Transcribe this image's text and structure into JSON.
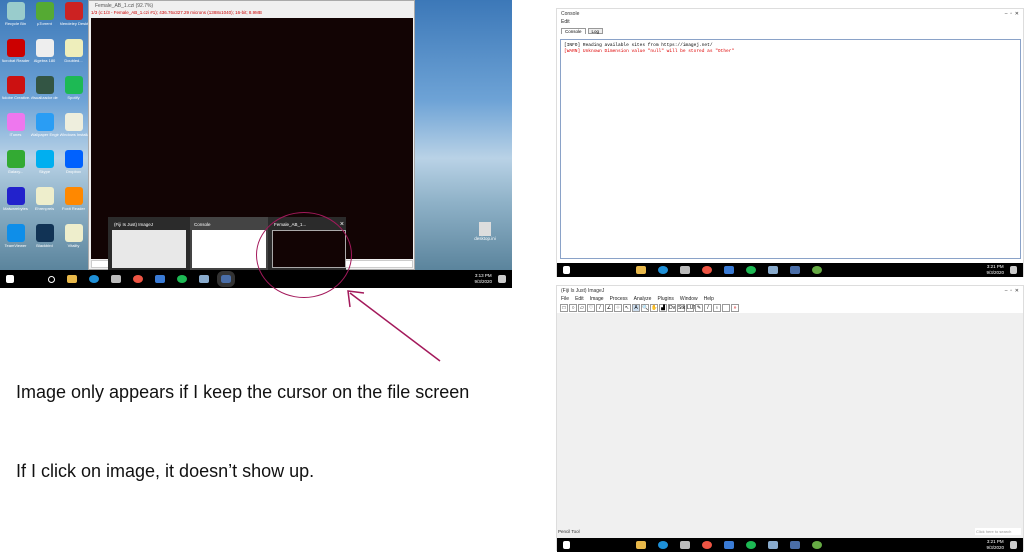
{
  "left_screenshot": {
    "desktop_icons": [
      "Recycle Bin",
      "µTorrent",
      "Mendeley Desktop",
      "Acrobat Reader DC",
      "Algebra 180",
      "Doubled...",
      "Adobe Creative...",
      "Visualizador de fotos",
      "Spotify",
      "iTunes",
      "Wallpaper Engine",
      "Windows Installation",
      "Galaxy...",
      "Skype",
      "Dropbox",
      "Malwarebytes",
      "Ehrenpreis",
      "Foxit Reader",
      "TeamViewer",
      "Blackbird",
      "Vitality"
    ],
    "icon_colors": [
      "#9cc",
      "#5a3",
      "#c22",
      "#c00",
      "#eee",
      "#eeb",
      "#c11",
      "#354",
      "#1db954",
      "#e7e",
      "#2a9df4",
      "#eed",
      "#3a3",
      "#00aff0",
      "#0061fe",
      "#22c",
      "#eec",
      "#f80",
      "#0e8ee9",
      "#135",
      "#eec"
    ],
    "image_window": {
      "title": "Female_AB_1.czi (92.7%)",
      "info": "1/3 (c:1/3 - Female_AB_1.czi #1); 436.76x327.29 microns (1388x1040); 16-bit; 8.9MB"
    },
    "thumbnails": [
      {
        "title": "(Fiji Is Just) ImageJ"
      },
      {
        "title": "Console"
      },
      {
        "title": "Female_AB_1..."
      }
    ],
    "desktop_file": "desktop.ini",
    "clock": {
      "time": "3:13 PM",
      "date": "9/3/2020"
    }
  },
  "annotations": {
    "caption1": "Image only appears if I keep the cursor on the file screen",
    "caption2": "If I click on image, it doesn’t show up.",
    "accent": "#a3195b"
  },
  "console_window": {
    "title": "Console",
    "menu": [
      "Edit"
    ],
    "tabs": [
      "Console",
      "Log"
    ],
    "lines": [
      {
        "text": "[INFO] Reading available sites from https://imagej.net/",
        "color": "#222"
      },
      {
        "text": "[WARN] Unknown Dimension value \"null\" will be stored as \"Other\"",
        "color": "#d00"
      }
    ],
    "clock": {
      "time": "3:21 PM",
      "date": "9/3/2020"
    }
  },
  "imagej_window": {
    "title": "(Fiji Is Just) ImageJ",
    "menu": [
      "File",
      "Edit",
      "Image",
      "Process",
      "Analyze",
      "Plugins",
      "Window",
      "Help"
    ],
    "tools": [
      "□",
      "○",
      "▱",
      "♡",
      "/",
      "∠",
      "⁘",
      "↖",
      "A",
      "🔍",
      "✋",
      "▟",
      "Dv",
      "Stk",
      "LUT",
      "✎",
      "/",
      "♁",
      "",
      "»"
    ],
    "status": "Pencil Tool",
    "search_placeholder": "Click here to search",
    "clock": {
      "time": "3:21 PM",
      "date": "9/3/2020"
    }
  }
}
